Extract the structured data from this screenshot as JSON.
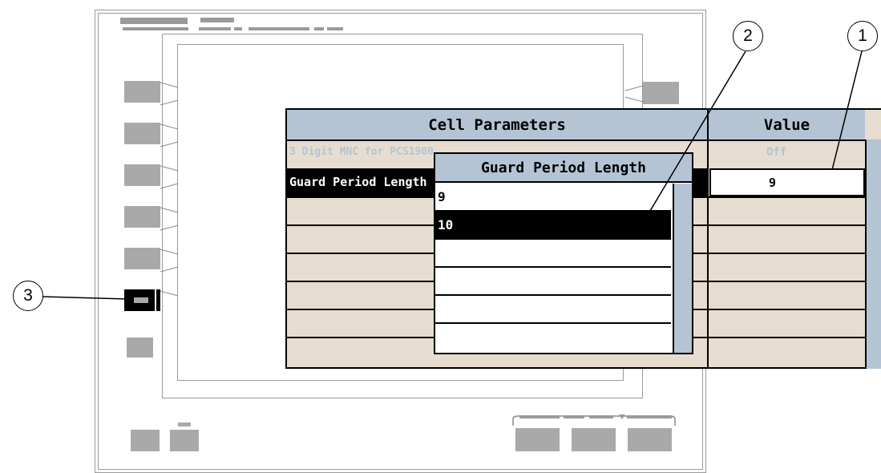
{
  "table": {
    "header_param": "Cell Parameters",
    "header_value": "Value",
    "rows": [
      {
        "param": "3 Digit MNC for PCS1900",
        "value": "Off",
        "state": "disabled"
      },
      {
        "param": "Guard Period Length",
        "value": "9",
        "state": "selected"
      }
    ]
  },
  "dropdown": {
    "title": "Guard Period Length",
    "options": [
      "9",
      "10",
      "",
      "",
      "",
      ""
    ],
    "selected_index": 1
  },
  "callouts": {
    "one": "1",
    "two": "2",
    "three": "3"
  },
  "colors": {
    "header_bg": "#b4c4d4",
    "cell_bg": "#e6ddd0",
    "disabled_text": "#b4c4d4",
    "selected_bg": "#000000",
    "softkey_gray": "#a9a9a9"
  }
}
